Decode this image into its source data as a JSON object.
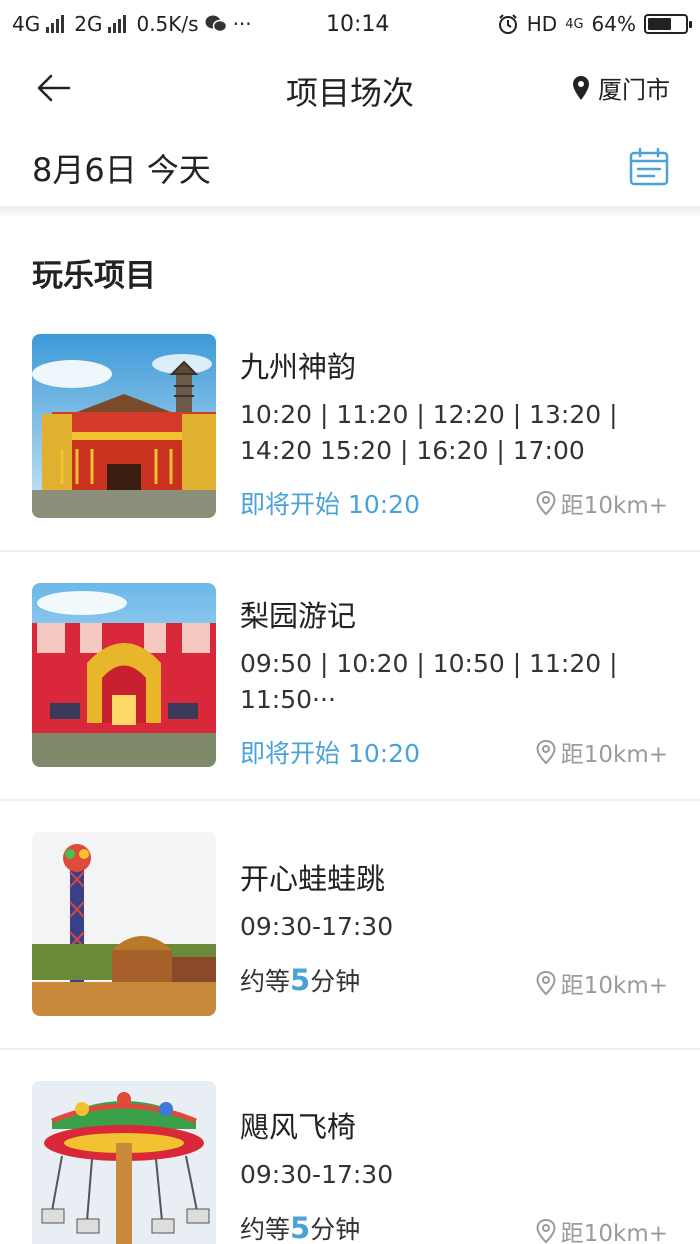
{
  "status_bar": {
    "network1": "4G",
    "network2": "2G",
    "speed": "0.5K/s",
    "extra": "···",
    "time": "10:14",
    "hd": "HD",
    "net_small": "4G",
    "battery": "64%",
    "battery_level": 0.64
  },
  "nav": {
    "title": "项目场次",
    "city": "厦门市"
  },
  "date_bar": {
    "date": "8月6日 今天"
  },
  "section": {
    "title": "玩乐项目"
  },
  "items": [
    {
      "name": "九州神韵",
      "times": "10:20 | 11:20 | 12:20 | 13:20 | 14:20 15:20 | 16:20 | 17:00",
      "status": "即将开始 10:20",
      "distance": "距10km+"
    },
    {
      "name": "梨园游记",
      "times": "09:50 | 10:20 | 10:50 | 11:20 | 11:50···",
      "status": "即将开始 10:20",
      "distance": "距10km+"
    },
    {
      "name": "开心蛙蛙跳",
      "times": "09:30-17:30",
      "wait_prefix": "约等",
      "wait_num": "5",
      "wait_suffix": "分钟",
      "distance": "距10km+"
    },
    {
      "name": "飓风飞椅",
      "times": "09:30-17:30",
      "wait_prefix": "约等",
      "wait_num": "5",
      "wait_suffix": "分钟",
      "distance": "距10km+"
    }
  ],
  "colors": {
    "accent": "#4aa3d8",
    "text": "#222222",
    "muted": "#9a9a9a"
  }
}
